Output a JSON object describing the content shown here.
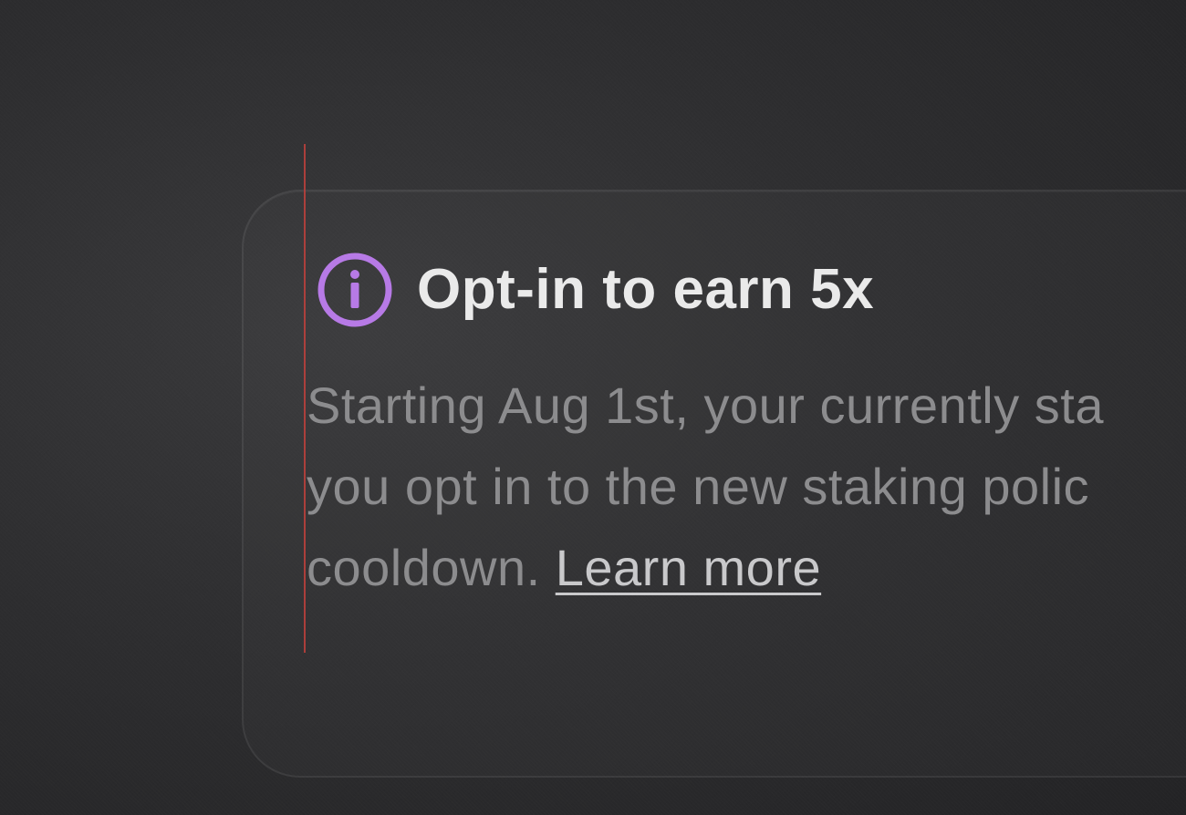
{
  "notice": {
    "icon": "info-icon",
    "icon_color": "#b77ae6",
    "title": "Opt-in to earn 5x",
    "body_lines": [
      "Starting Aug 1st, your currently sta",
      "you opt in to the new staking polic",
      "cooldown."
    ],
    "learn_more_label": "Learn more"
  },
  "colors": {
    "accent_line": "#c1413c",
    "title": "#eaeaea",
    "body": "#8c8c8e",
    "link": "#c9c9cb"
  }
}
